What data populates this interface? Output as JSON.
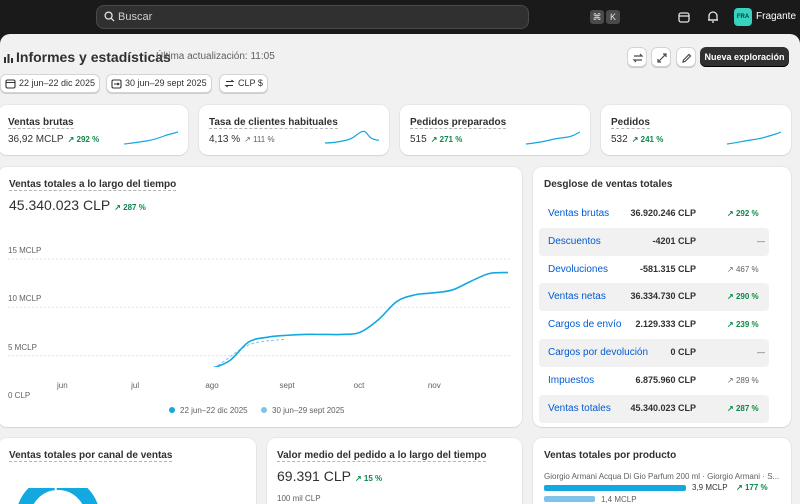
{
  "topbar": {
    "search_placeholder": "Buscar",
    "kbd_cmd": "⌘",
    "kbd_key": "K",
    "store_initials": "FRA",
    "store_name": "Fragante",
    "icons": [
      "search-icon",
      "store-icon",
      "bell-icon"
    ]
  },
  "header": {
    "title": "Informes y estadísticas",
    "last_update": "Última actualización: 11:05",
    "primary_button": "Nueva exploración",
    "icon_buttons": [
      "refresh-icon",
      "fullscreen-icon",
      "edit-icon"
    ]
  },
  "filters": {
    "date_range": "22 jun–22 dic 2025",
    "compare_range": "30 jun–29 sept 2025",
    "currency": "CLP $"
  },
  "metrics": [
    {
      "label": "Ventas brutas",
      "value": "36,92 MCLP",
      "change": "292 %",
      "trend": "up"
    },
    {
      "label": "Tasa de clientes habituales",
      "value": "4,13 %",
      "change": "111 %",
      "trend": "neutral"
    },
    {
      "label": "Pedidos preparados",
      "value": "515",
      "change": "271 %",
      "trend": "up"
    },
    {
      "label": "Pedidos",
      "value": "532",
      "change": "241 %",
      "trend": "up"
    }
  ],
  "sales_over_time": {
    "title": "Ventas totales a lo largo del tiempo",
    "value": "45.340.023 CLP",
    "change": "287 %",
    "legend_current": "22 jun–22 dic 2025",
    "legend_previous": "30 jun–29 sept 2025"
  },
  "chart_data": {
    "type": "line",
    "title": "Ventas totales a lo largo del tiempo",
    "x_ticks": [
      "jun",
      "jul",
      "ago",
      "sept",
      "oct",
      "nov"
    ],
    "y_ticks": [
      "15 MCLP",
      "10 MCLP",
      "5 MCLP",
      "0 CLP"
    ],
    "ylim": [
      0,
      15000000
    ],
    "grid": true,
    "legend_position": "bottom",
    "series": [
      {
        "name": "22 jun–22 dic 2025",
        "color": "#13a8e0",
        "style": "solid",
        "x": [
          0,
          0.25,
          0.5,
          0.75,
          1,
          1.25,
          1.5,
          1.75,
          2,
          2.25,
          2.5,
          2.75,
          3,
          3.25,
          3.5,
          3.75,
          4,
          4.25,
          4.5,
          4.75,
          5,
          5.25,
          5.5,
          5.75,
          6
        ],
        "values": [
          0,
          300000,
          1200000,
          1700000,
          1800000,
          2000000,
          2900000,
          3500000,
          3700000,
          4500000,
          6400000,
          6900000,
          7100000,
          7200000,
          7200000,
          7200000,
          7400000,
          8700000,
          10600000,
          11300000,
          11500000,
          11800000,
          12700000,
          13500000,
          13600000
        ]
      },
      {
        "name": "30 jun–29 sept 2025",
        "color": "#7fc4e8",
        "style": "dashed",
        "x": [
          0,
          0.5,
          1,
          1.5,
          2,
          2.5,
          3
        ],
        "values": [
          0,
          900000,
          1700000,
          2500000,
          3600000,
          6100000,
          6700000
        ]
      }
    ]
  },
  "breakdown": {
    "title": "Desglose de ventas totales",
    "rows": [
      {
        "label": "Ventas brutas",
        "value": "36.920.246 CLP",
        "change": "292 %",
        "trend": "up"
      },
      {
        "label": "Descuentos",
        "value": "-4201 CLP",
        "change": "—",
        "trend": "none"
      },
      {
        "label": "Devoluciones",
        "value": "-581.315 CLP",
        "change": "467 %",
        "trend": "neutral"
      },
      {
        "label": "Ventas netas",
        "value": "36.334.730 CLP",
        "change": "290 %",
        "trend": "up"
      },
      {
        "label": "Cargos de envío",
        "value": "2.129.333 CLP",
        "change": "239 %",
        "trend": "up"
      },
      {
        "label": "Cargos por devolución",
        "value": "0 CLP",
        "change": "—",
        "trend": "none"
      },
      {
        "label": "Impuestos",
        "value": "6.875.960 CLP",
        "change": "289 %",
        "trend": "neutral"
      },
      {
        "label": "Ventas totales",
        "value": "45.340.023 CLP",
        "change": "287 %",
        "trend": "up"
      }
    ]
  },
  "bottom": {
    "channel_title": "Ventas totales por canal de ventas",
    "aov_title": "Valor medio del pedido a lo largo del tiempo",
    "aov_value": "69.391 CLP",
    "aov_change": "15 %",
    "aov_y_top": "100 mil CLP",
    "product_title": "Ventas totales por producto",
    "product_name": "Giorgio Armani Acqua Di Gio Parfum 200 ml · Giorgio Armani · S...",
    "product_value": "3,9 MCLP",
    "product_change": "177 %",
    "product_prev_value": "1,4 MCLP"
  },
  "colors": {
    "accent": "#13a8e0",
    "accent_light": "#7fc4e8",
    "link": "#005bd3",
    "positive": "#0c8748",
    "dark": "#303030"
  }
}
